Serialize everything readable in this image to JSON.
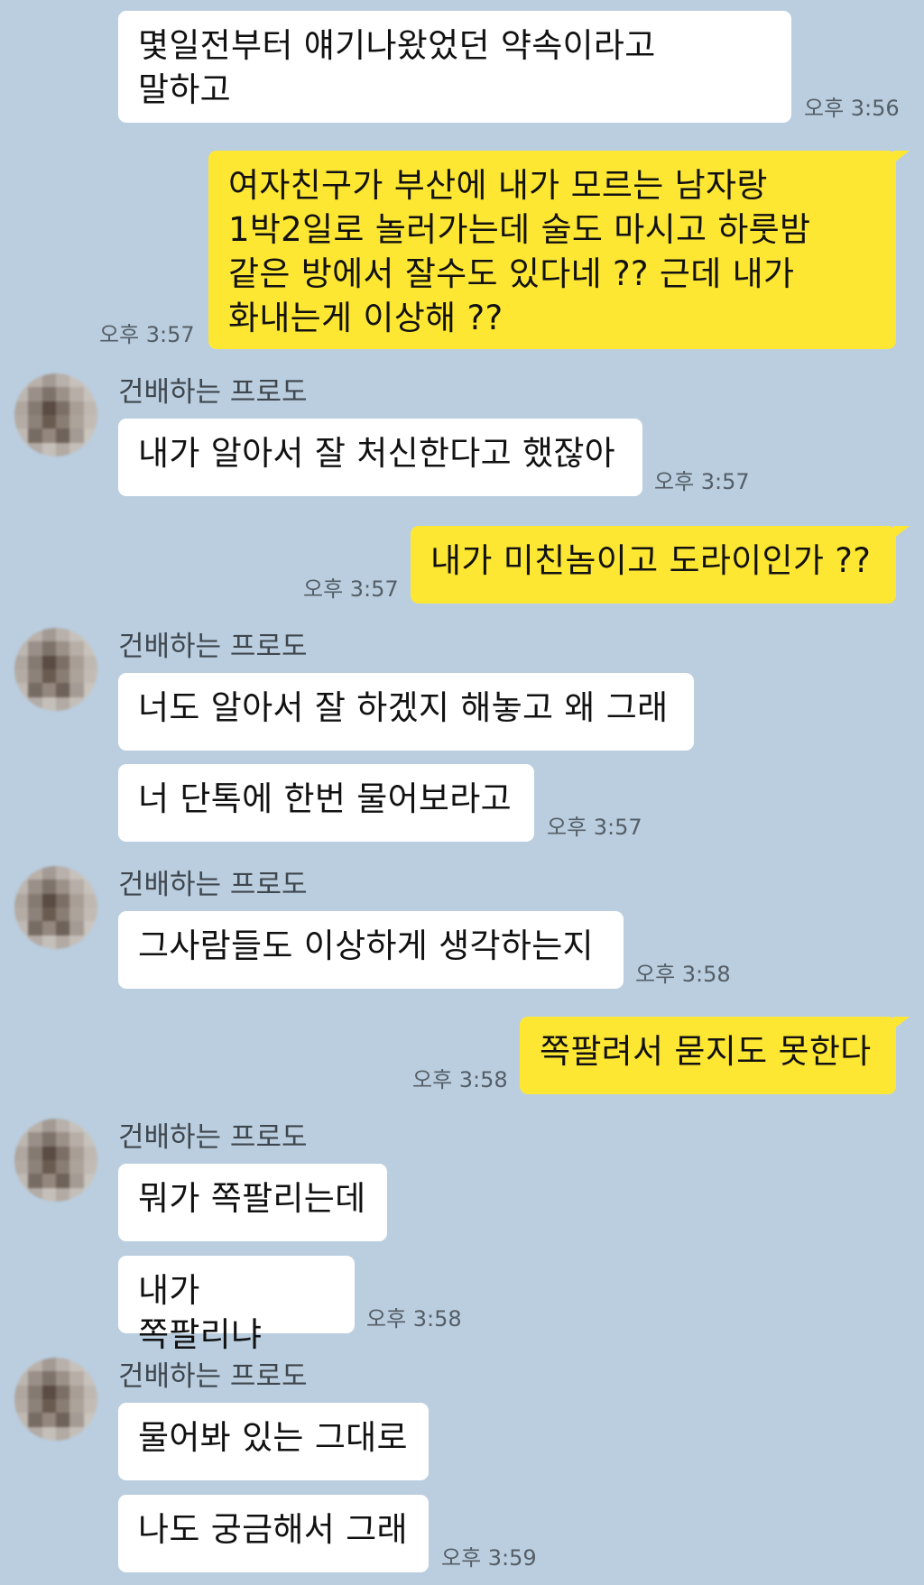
{
  "contact_name": "건배하는 프로도",
  "messages": [
    {
      "text": "몇일전부터 얘기나왔었던 약속이라고\n말하고",
      "time": "오후 3:56"
    },
    {
      "text": "여자친구가 부산에 내가 모르는 남자랑\n1박2일로 놀러가는데 술도 마시고 하룻밤\n같은 방에서 잘수도 있다네 ?? 근데 내가\n화내는게 이상해 ??",
      "time": "오후 3:57"
    },
    {
      "text": "내가 알아서 잘 처신한다고 했잖아",
      "time": "오후 3:57"
    },
    {
      "text": "내가 미친놈이고 도라이인가 ??",
      "time": "오후 3:57"
    },
    {
      "text": "너도 알아서 잘 하겠지 해놓고 왜 그래"
    },
    {
      "text": "너 단톡에 한번 물어보라고",
      "time": "오후 3:57"
    },
    {
      "text": "그사람들도 이상하게 생각하는지",
      "time": "오후 3:58"
    },
    {
      "text": "쪽팔려서 묻지도 못한다",
      "time": "오후 3:58"
    },
    {
      "text": "뭐가 쪽팔리는데"
    },
    {
      "text": "내가 쪽팔리냐",
      "time": "오후 3:58"
    },
    {
      "text": "물어봐 있는 그대로"
    },
    {
      "text": "나도 궁금해서 그래",
      "time": "오후 3:59"
    }
  ],
  "colors": {
    "background": "#bacee0",
    "outgoing_bubble": "#fee733",
    "incoming_bubble": "#ffffff"
  }
}
